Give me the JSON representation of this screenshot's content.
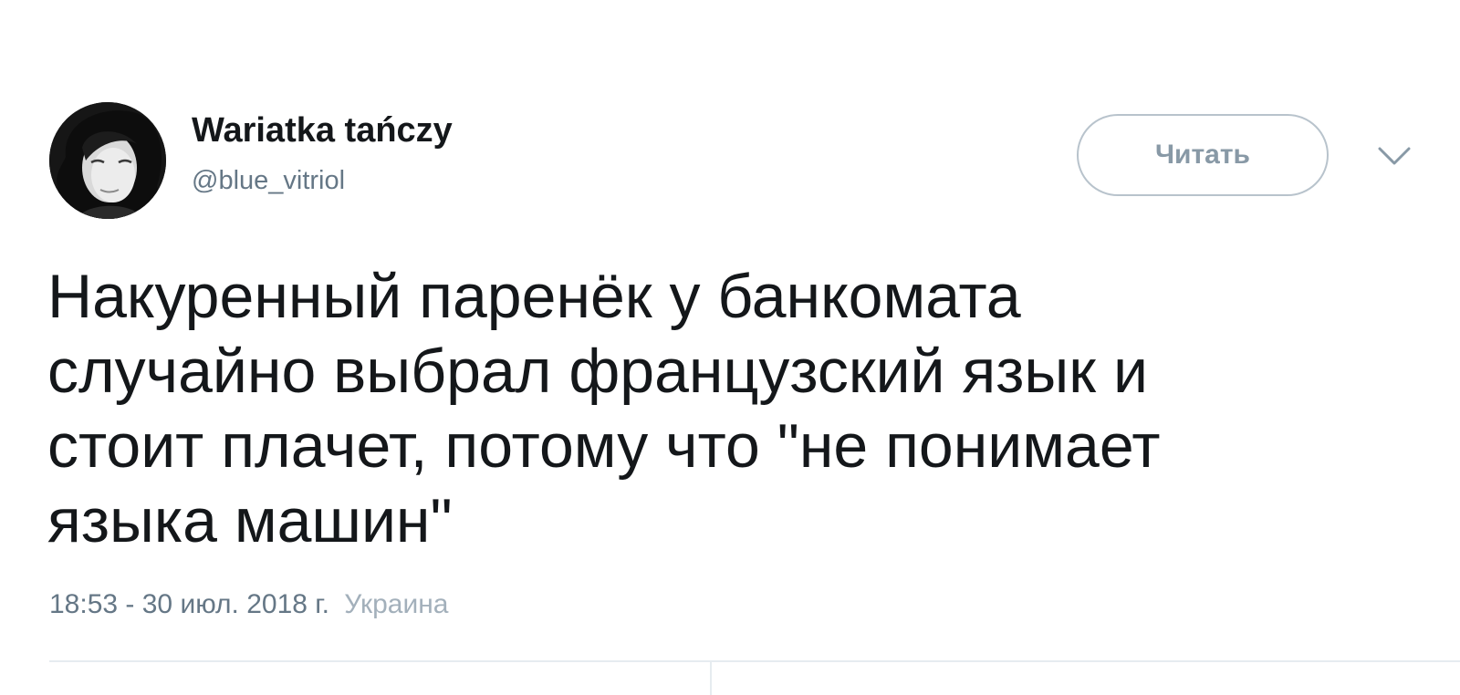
{
  "author": {
    "name": "Wariatka tańczy",
    "handle": "@blue_vitriol"
  },
  "follow_button": {
    "label": "Читать"
  },
  "tweet": {
    "lines": [
      "Накуренный паренёк у банкомата",
      "случайно выбрал французский язык и",
      "стоит плачет, потому что \"не понимает",
      "языка машин\""
    ],
    "timestamp": "18:53 - 30 июл. 2018 г.",
    "location": "Украина"
  },
  "icons": {
    "avatar": "profile-photo",
    "caret": "chevron-down-icon"
  }
}
